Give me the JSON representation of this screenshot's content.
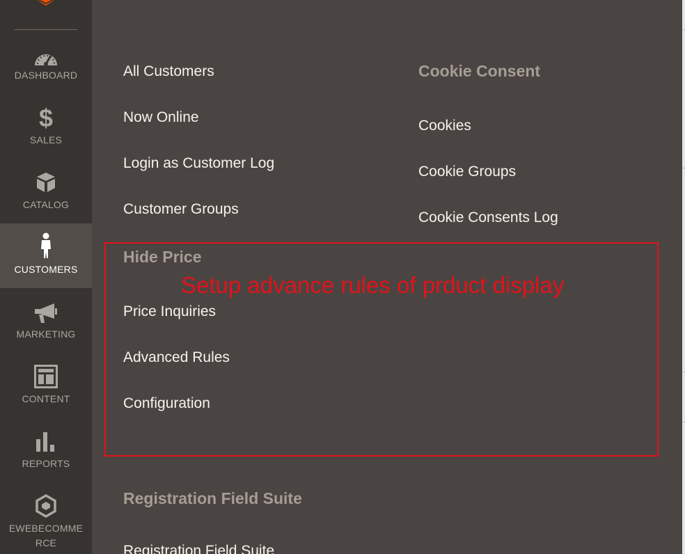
{
  "sidebar": {
    "items": [
      {
        "label": "DASHBOARD",
        "icon": "dashboard-gauge-icon"
      },
      {
        "label": "SALES",
        "icon": "dollar-icon"
      },
      {
        "label": "CATALOG",
        "icon": "box-icon"
      },
      {
        "label": "CUSTOMERS",
        "icon": "person-icon",
        "active": true
      },
      {
        "label": "MARKETING",
        "icon": "megaphone-icon"
      },
      {
        "label": "CONTENT",
        "icon": "layout-icon"
      },
      {
        "label": "REPORTS",
        "icon": "bar-chart-icon"
      },
      {
        "label_line1": "EWEBECOMME",
        "label_line2": "RCE",
        "icon": "hexagon-logo-icon"
      }
    ]
  },
  "flyout": {
    "customers_links": [
      "All Customers",
      "Now Online",
      "Login as Customer Log",
      "Customer Groups"
    ],
    "cookie_consent": {
      "heading": "Cookie Consent",
      "links": [
        "Cookies",
        "Cookie Groups",
        "Cookie Consents Log"
      ]
    },
    "hide_price": {
      "heading": "Hide Price",
      "links": [
        "Price Inquiries",
        "Advanced Rules",
        "Configuration"
      ]
    },
    "registration_field_suite": {
      "heading": "Registration Field Suite",
      "links": [
        "Registration Field Suite"
      ]
    }
  },
  "annotation": {
    "text": "Setup advance rules of prduct display"
  },
  "colors": {
    "sidebar_bg": "#373330",
    "sidebar_active_bg": "#524d49",
    "flyout_bg": "#4a4542",
    "brand_orange": "#eb5202",
    "annotation_red": "#e3121b"
  }
}
